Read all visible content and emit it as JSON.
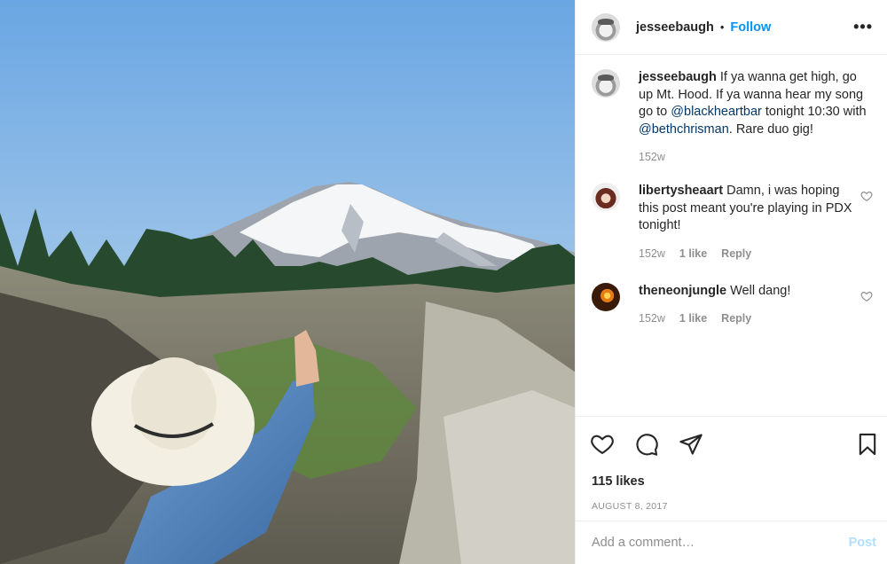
{
  "post": {
    "username": "jesseebaugh",
    "dot": "•",
    "follow_label": "Follow",
    "more_label": "•••"
  },
  "caption": {
    "username": "jesseebaugh",
    "text_1": " If ya wanna get high, go up Mt. Hood. If ya wanna hear my song go to ",
    "mention_1": "@blackheartbar",
    "text_2": " tonight 10:30 with ",
    "mention_2": "@bethchrisman",
    "text_3": ". Rare duo gig!",
    "time": "152w"
  },
  "comments": [
    {
      "username": "libertysheaart",
      "text": " Damn, i was hoping this post meant you're playing in PDX tonight!",
      "time": "152w",
      "likes": "1 like",
      "reply": "Reply"
    },
    {
      "username": "theneonjungle",
      "text": " Well dang!",
      "time": "152w",
      "likes": "1 like",
      "reply": "Reply"
    }
  ],
  "likes": "115 likes",
  "date": "AUGUST 8, 2017",
  "add_comment": {
    "placeholder": "Add a comment…",
    "post_label": "Post"
  },
  "icons": [
    "heart-icon",
    "comment-icon",
    "share-icon",
    "bookmark-icon",
    "ellipsis-icon"
  ],
  "colors": {
    "accent": "#0095f6",
    "mention": "#00376b",
    "muted": "#8e8e8e",
    "post_disabled": "#b2dffc"
  }
}
